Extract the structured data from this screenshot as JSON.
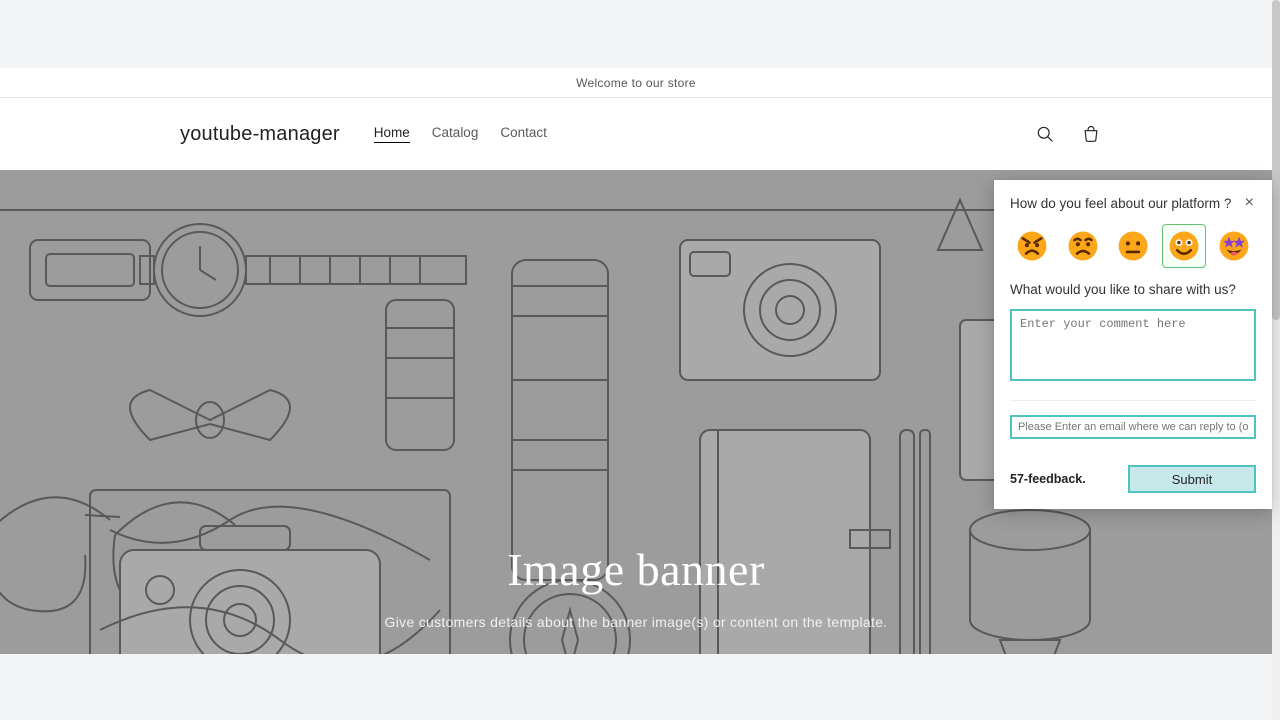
{
  "announcement": "Welcome to our store",
  "site": {
    "name": "youtube-manager"
  },
  "nav": {
    "items": [
      {
        "label": "Home",
        "active": true
      },
      {
        "label": "Catalog",
        "active": false
      },
      {
        "label": "Contact",
        "active": false
      }
    ]
  },
  "header_icons": {
    "search": "search-icon",
    "cart": "cart-icon"
  },
  "hero": {
    "title": "Image banner",
    "subtitle": "Give customers details about the banner image(s) or content on the template."
  },
  "feedback": {
    "question": "How do you feel about our platform ?",
    "close": "×",
    "emojis": [
      "angry",
      "sad",
      "neutral",
      "happy",
      "star-struck"
    ],
    "selected_index": 3,
    "share_prompt": "What would you like to share with us?",
    "comment_placeholder": "Enter your comment here",
    "email_placeholder": "Please Enter an email where we can reply to (optional)",
    "brand": "57-feedback.",
    "submit_label": "Submit"
  },
  "colors": {
    "accent_teal": "#4fc2c2",
    "accent_green": "#62c271",
    "emoji_orange": "#fca61a"
  }
}
